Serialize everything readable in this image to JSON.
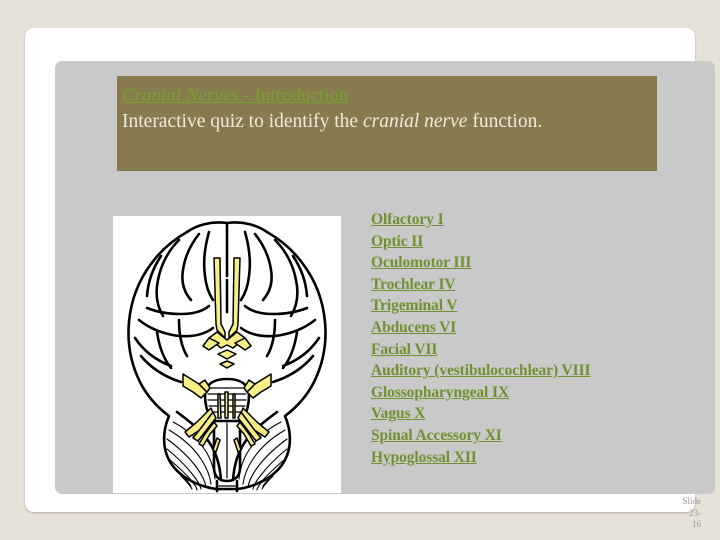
{
  "slide": {
    "title": {
      "italic_part": "Cranial Nerves",
      "separator": " - ",
      "plain_part": "Introduction"
    },
    "subtitle": {
      "lead": "Interactive quiz to identify the ",
      "emphasis": "cranial nerve",
      "tail": " function."
    },
    "figure": {
      "caption": "inferior-view-of-brain-with-cranial-nerves"
    },
    "nerves": [
      "Olfactory I",
      "Optic II",
      "Oculomotor III",
      "Trochlear IV",
      "Trigeminal V",
      "Abducens VI",
      "Facial VII",
      "Auditory (vestibulocochlear) VIII",
      "Glossopharyngeal IX",
      "Vagus X",
      "Spinal Accessory XI",
      "Hypoglossal XII"
    ],
    "page_marker": {
      "label": "Slide",
      "number_line1": "23-",
      "number_line2": "16"
    },
    "colors": {
      "banner": "#877a4f",
      "title_green": "#76a12d",
      "list_green": "#6f9131",
      "subtitle_cream": "#efeadd",
      "canvas_gray": "#c9c9c9",
      "page_beige": "#e7e2d8",
      "nerve_highlight": "#f5e97e"
    }
  }
}
